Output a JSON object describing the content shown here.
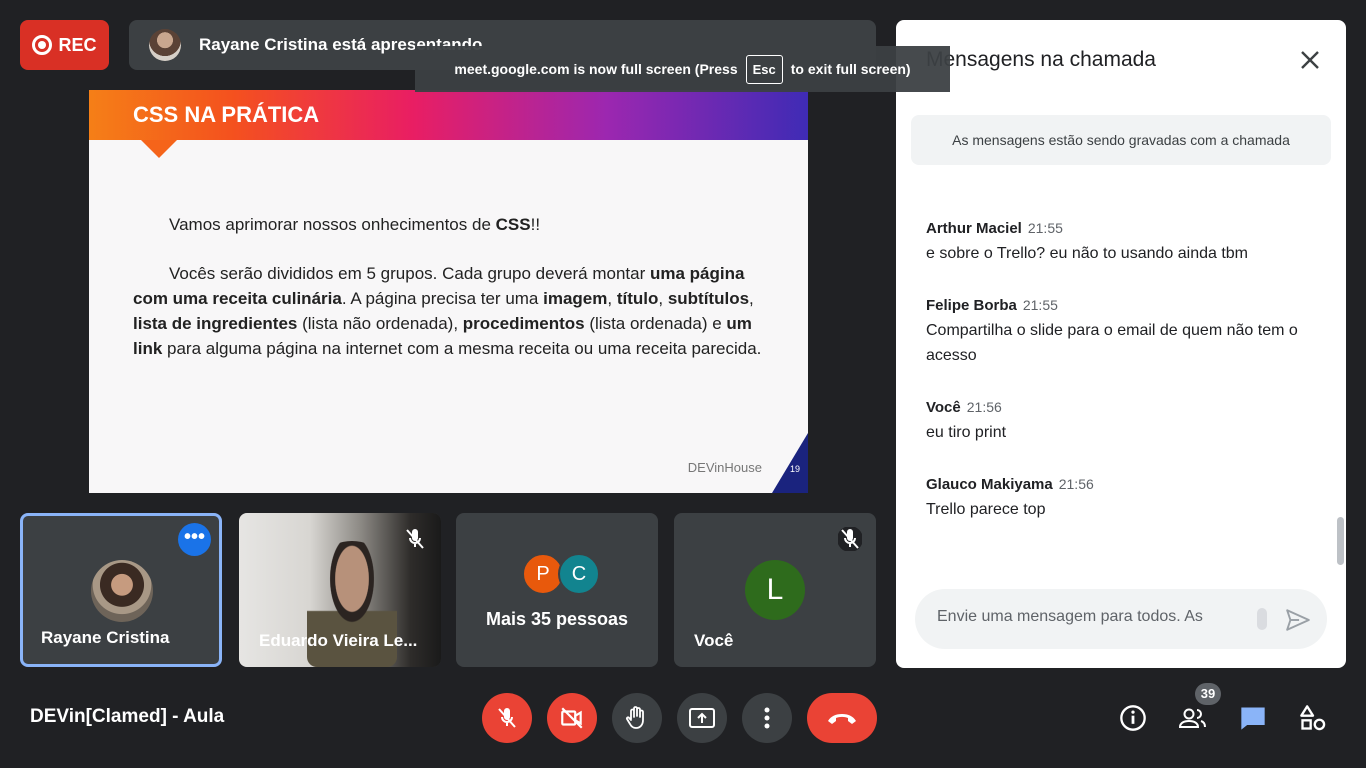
{
  "recording": {
    "label": "REC"
  },
  "presenting": {
    "text": "Rayane Cristina está apresentando"
  },
  "fullscreen_notice": {
    "before": "meet.google.com is now full screen (Press",
    "key": "Esc",
    "after": "to exit full screen)"
  },
  "slide": {
    "title": "CSS NA PRÁTICA",
    "p1": {
      "t1": "Vamos aprimorar nossos onhecimentos de ",
      "b1": "CSS",
      "t2": "!!"
    },
    "p2": {
      "t1": "Vocês serão divididos em 5 grupos. Cada grupo deverá montar ",
      "b1": "uma página com uma receita culinária",
      "t2": ". A página precisa ter uma ",
      "b2": "imagem",
      "t3": ", ",
      "b3": "título",
      "t4": ", ",
      "b4": "subtítulos",
      "t5": ", ",
      "b5": "lista de ingredientes",
      "t6": " (lista não ordenada), ",
      "b6": "procedimentos",
      "t7": " (lista ordenada) e ",
      "b7": "um link",
      "t8": " para alguma página na internet com a mesma receita ou uma receita parecida."
    },
    "footer": "DEVinHouse",
    "page_number": "19"
  },
  "tiles": [
    {
      "name": "Rayane Cristina",
      "menu": "•••"
    },
    {
      "name": "Eduardo Vieira Le..."
    },
    {
      "name": "Mais 35 pessoas",
      "initials": [
        "P",
        "C"
      ],
      "colors": [
        "#e8590c",
        "#12848f"
      ]
    },
    {
      "name": "Você",
      "initial": "L"
    }
  ],
  "meeting": {
    "title": "DEVin[Clamed] - Aula"
  },
  "controls": [
    "mic-off-icon",
    "camera-off-icon",
    "raise-hand-icon",
    "present-icon",
    "more-vert-icon",
    "end-call-icon"
  ],
  "right_controls": {
    "participants_count": "39",
    "icons": [
      "info-icon",
      "people-icon",
      "chat-icon",
      "activities-icon"
    ]
  },
  "chat": {
    "title": "Mensagens na chamada",
    "note": "As mensagens estão sendo gravadas com a chamada",
    "messages": [
      {
        "author": "Arthur Maciel",
        "time": "21:55",
        "text": "e sobre o Trello? eu não to usando ainda tbm"
      },
      {
        "author": "Felipe Borba",
        "time": "21:55",
        "text": "Compartilha o slide para o email de quem não tem o acesso"
      },
      {
        "author": "Você",
        "time": "21:56",
        "text": "eu tiro print"
      },
      {
        "author": "Glauco Makiyama",
        "time": "21:56",
        "text": "Trello parece top"
      }
    ],
    "input_placeholder": "Envie uma mensagem para todos. As"
  },
  "colors": {
    "background": "#202124",
    "tile": "#3c4043",
    "danger": "#ea4335",
    "accent": "#1a73e8",
    "chat_accent": "#8ab4f8"
  }
}
